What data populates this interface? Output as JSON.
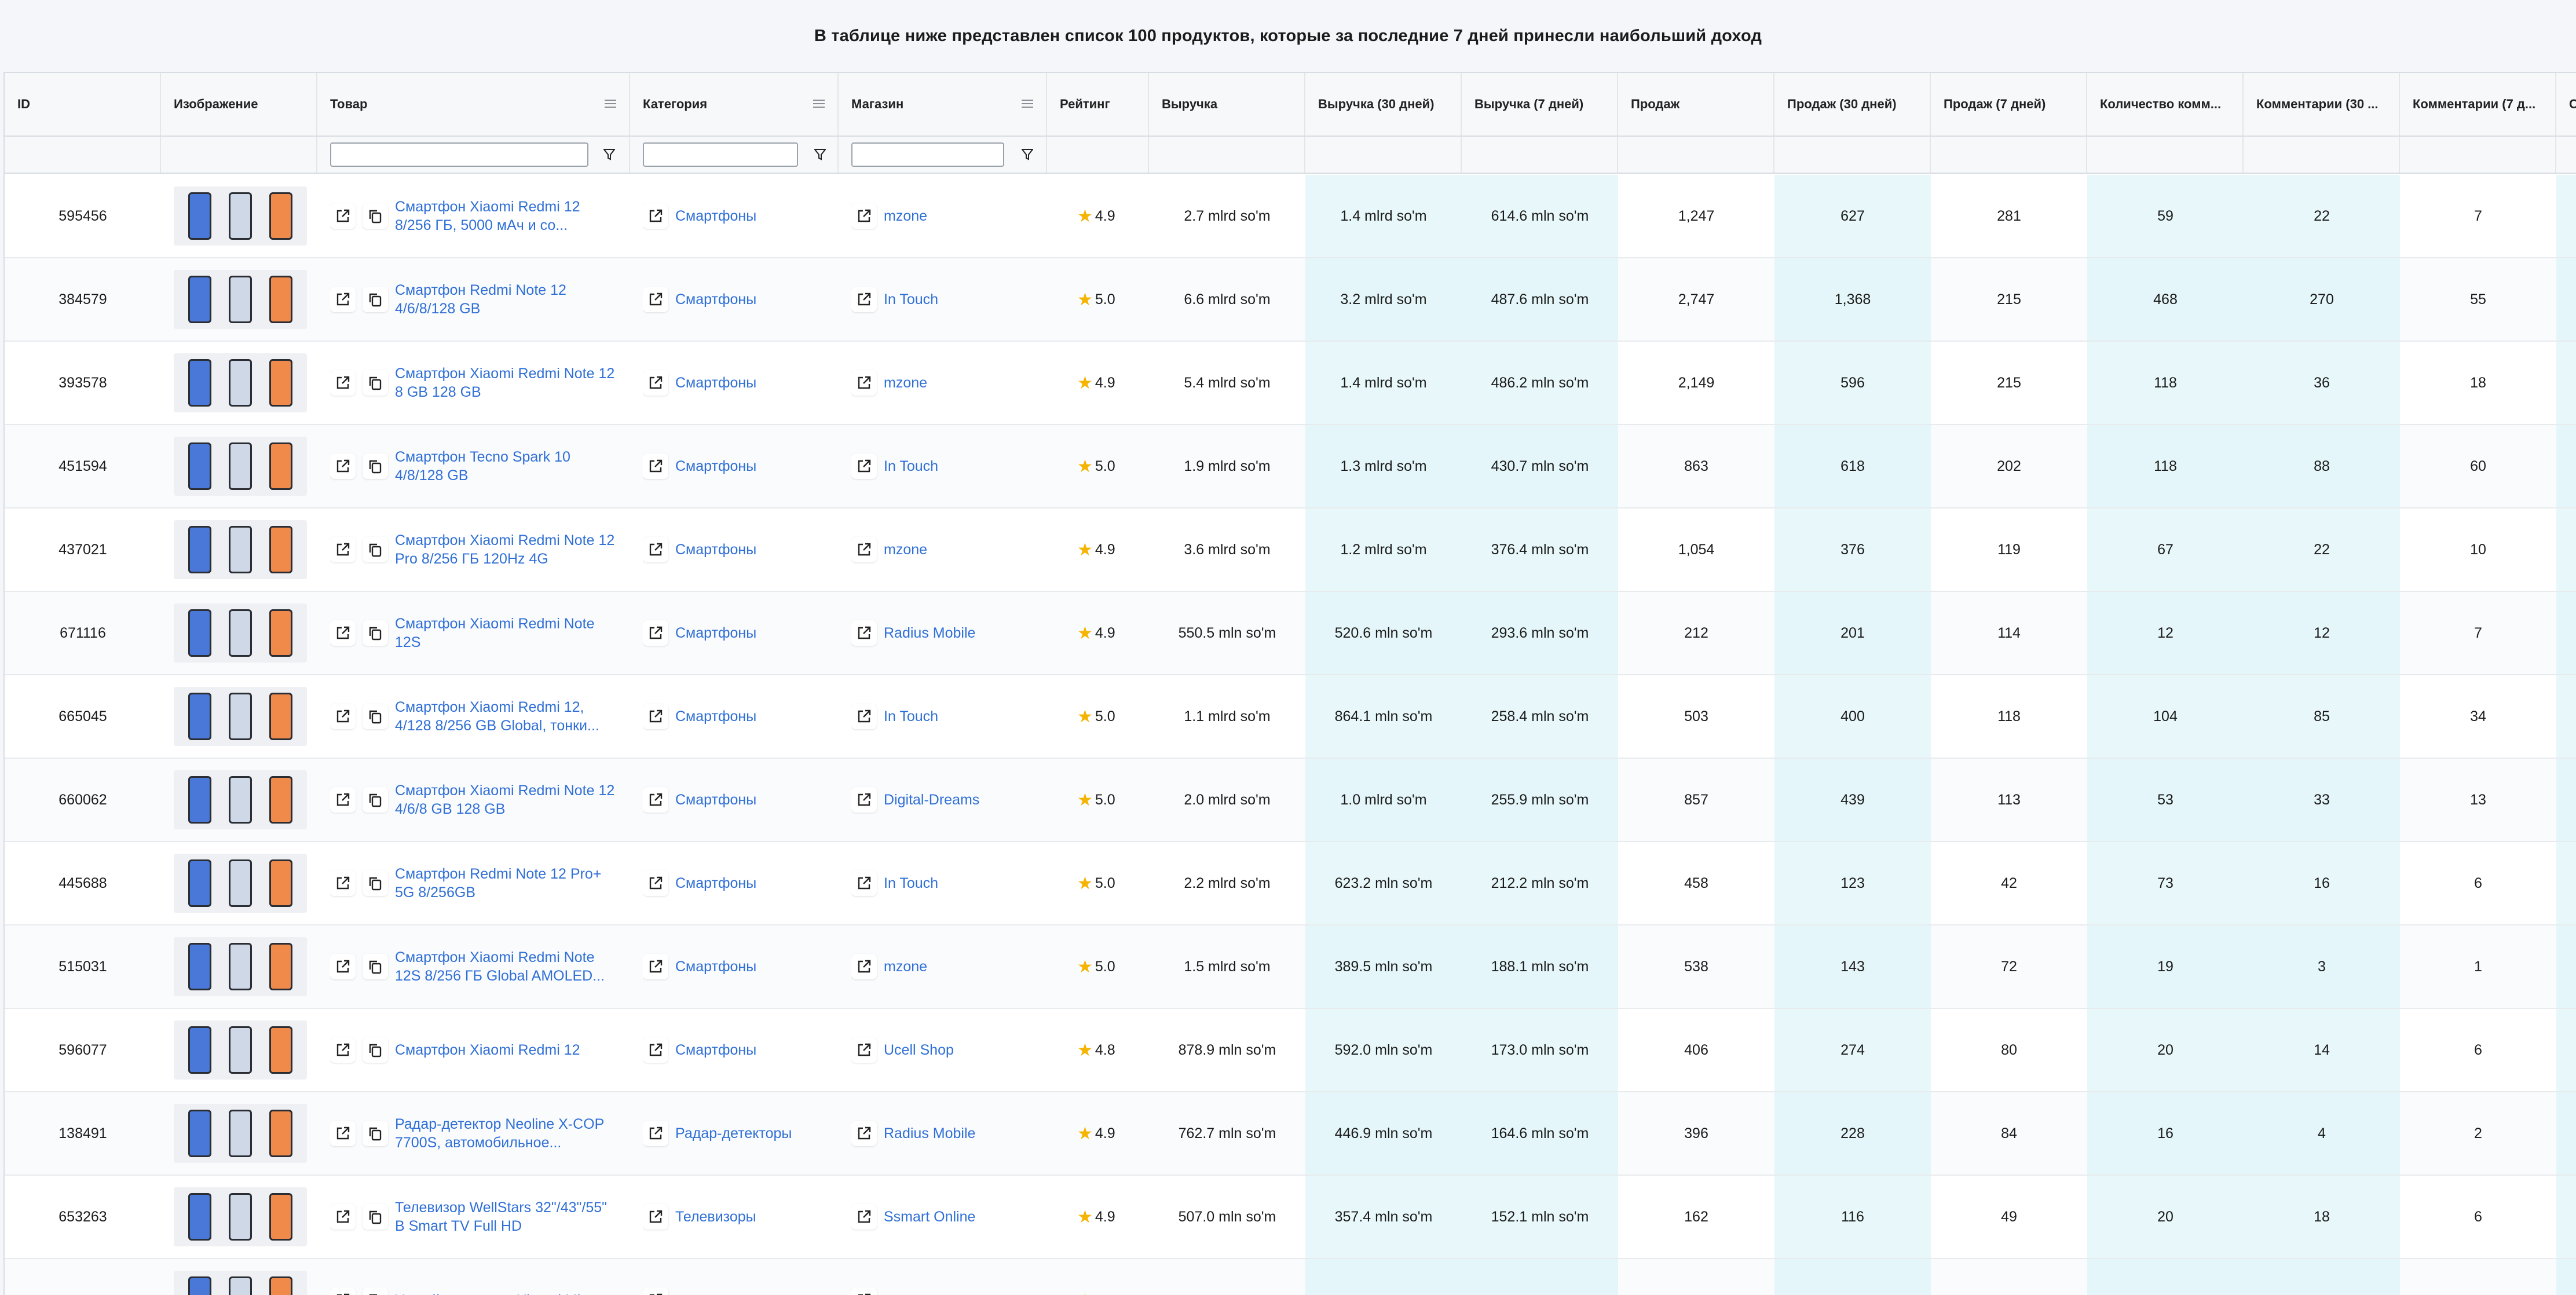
{
  "page_title": "В таблице ниже представлен список 100 продуктов, которые за последние 7 дней принесли наибольший доход",
  "columns": {
    "id": "ID",
    "image": "Изображение",
    "product": "Товар",
    "category": "Категория",
    "shop": "Магазин",
    "rating": "Рейтинг",
    "revenue": "Выручка",
    "revenue30": "Выручка (30 дней)",
    "revenue7": "Выручка (7 дней)",
    "sales": "Продаж",
    "sales30": "Продаж (30 дней)",
    "sales7": "Продаж (7 дней)",
    "comments": "Количество комм...",
    "comments30": "Комментарии (30 ...",
    "comments7": "Комментарии (7 д...",
    "next": "С"
  },
  "filters": {
    "product": "",
    "category": "",
    "shop": ""
  },
  "colors": {
    "link": "#2f6fd6",
    "highlight_column": "#e8f8fa",
    "star": "#f5b400"
  },
  "rows": [
    {
      "id": "595456",
      "product": "Смартфон Xiaomi Redmi 12 8/256 ГБ, 5000 мАч и со...",
      "category": "Смартфоны",
      "shop": "mzone",
      "rating": "4.9",
      "revenue": "2.7 mlrd so'm",
      "revenue30": "1.4 mlrd so'm",
      "revenue7": "614.6 mln so'm",
      "sales": "1,247",
      "sales30": "627",
      "sales7": "281",
      "comments": "59",
      "comments30": "22",
      "comments7": "7"
    },
    {
      "id": "384579",
      "product": "Смартфон Redmi Note 12 4/6/8/128 GB",
      "category": "Смартфоны",
      "shop": "In Touch",
      "rating": "5.0",
      "revenue": "6.6 mlrd so'm",
      "revenue30": "3.2 mlrd so'm",
      "revenue7": "487.6 mln so'm",
      "sales": "2,747",
      "sales30": "1,368",
      "sales7": "215",
      "comments": "468",
      "comments30": "270",
      "comments7": "55"
    },
    {
      "id": "393578",
      "product": "Смартфон Xiaomi Redmi Note 12 8 GB 128 GB",
      "category": "Смартфоны",
      "shop": "mzone",
      "rating": "4.9",
      "revenue": "5.4 mlrd so'm",
      "revenue30": "1.4 mlrd so'm",
      "revenue7": "486.2 mln so'm",
      "sales": "2,149",
      "sales30": "596",
      "sales7": "215",
      "comments": "118",
      "comments30": "36",
      "comments7": "18"
    },
    {
      "id": "451594",
      "product": "Смартфон Tecno Spark 10 4/8/128 GB",
      "category": "Смартфоны",
      "shop": "In Touch",
      "rating": "5.0",
      "revenue": "1.9 mlrd so'm",
      "revenue30": "1.3 mlrd so'm",
      "revenue7": "430.7 mln so'm",
      "sales": "863",
      "sales30": "618",
      "sales7": "202",
      "comments": "118",
      "comments30": "88",
      "comments7": "60"
    },
    {
      "id": "437021",
      "product": "Смартфон Xiaomi Redmi Note 12 Pro 8/256 ГБ 120Hz 4G",
      "category": "Смартфоны",
      "shop": "mzone",
      "rating": "4.9",
      "revenue": "3.6 mlrd so'm",
      "revenue30": "1.2 mlrd so'm",
      "revenue7": "376.4 mln so'm",
      "sales": "1,054",
      "sales30": "376",
      "sales7": "119",
      "comments": "67",
      "comments30": "22",
      "comments7": "10"
    },
    {
      "id": "671116",
      "product": "Смартфон Xiaomi Redmi Note 12S",
      "category": "Смартфоны",
      "shop": "Radius Mobile",
      "rating": "4.9",
      "revenue": "550.5 mln so'm",
      "revenue30": "520.6 mln so'm",
      "revenue7": "293.6 mln so'm",
      "sales": "212",
      "sales30": "201",
      "sales7": "114",
      "comments": "12",
      "comments30": "12",
      "comments7": "7"
    },
    {
      "id": "665045",
      "product": "Смартфон Xiaomi Redmi 12, 4/128 8/256 GB Global, тонки...",
      "category": "Смартфоны",
      "shop": "In Touch",
      "rating": "5.0",
      "revenue": "1.1 mlrd so'm",
      "revenue30": "864.1 mln so'm",
      "revenue7": "258.4 mln so'm",
      "sales": "503",
      "sales30": "400",
      "sales7": "118",
      "comments": "104",
      "comments30": "85",
      "comments7": "34"
    },
    {
      "id": "660062",
      "product": "Смартфон Xiaomi Redmi Note 12 4/6/8 GB 128 GB",
      "category": "Смартфоны",
      "shop": "Digital-Dreams",
      "rating": "5.0",
      "revenue": "2.0 mlrd so'm",
      "revenue30": "1.0 mlrd so'm",
      "revenue7": "255.9 mln so'm",
      "sales": "857",
      "sales30": "439",
      "sales7": "113",
      "comments": "53",
      "comments30": "33",
      "comments7": "13"
    },
    {
      "id": "445688",
      "product": "Смартфон Redmi Note 12 Pro+ 5G 8/256GB",
      "category": "Смартфоны",
      "shop": "In Touch",
      "rating": "5.0",
      "revenue": "2.2 mlrd so'm",
      "revenue30": "623.2 mln so'm",
      "revenue7": "212.2 mln so'm",
      "sales": "458",
      "sales30": "123",
      "sales7": "42",
      "comments": "73",
      "comments30": "16",
      "comments7": "6"
    },
    {
      "id": "515031",
      "product": "Смартфон Xiaomi Redmi Note 12S 8/256 ГБ Global AMOLED...",
      "category": "Смартфоны",
      "shop": "mzone",
      "rating": "5.0",
      "revenue": "1.5 mlrd so'm",
      "revenue30": "389.5 mln so'm",
      "revenue7": "188.1 mln so'm",
      "sales": "538",
      "sales30": "143",
      "sales7": "72",
      "comments": "19",
      "comments30": "3",
      "comments7": "1"
    },
    {
      "id": "596077",
      "product": "Смартфон Xiaomi Redmi 12",
      "category": "Смартфоны",
      "shop": "Ucell Shop",
      "rating": "4.8",
      "revenue": "878.9 mln so'm",
      "revenue30": "592.0 mln so'm",
      "revenue7": "173.0 mln so'm",
      "sales": "406",
      "sales30": "274",
      "sales7": "80",
      "comments": "20",
      "comments30": "14",
      "comments7": "6"
    },
    {
      "id": "138491",
      "product": "Радар-детектор Neoline X-COP 7700S, автомобильное...",
      "category": "Радар-детекторы",
      "shop": "Radius Mobile",
      "rating": "4.9",
      "revenue": "762.7 mln so'm",
      "revenue30": "446.9 mln so'm",
      "revenue7": "164.6 mln so'm",
      "sales": "396",
      "sales30": "228",
      "sales7": "84",
      "comments": "16",
      "comments30": "4",
      "comments7": "2"
    },
    {
      "id": "653263",
      "product": "Телевизор WellStars 32\"/43\"/55\" В Smart TV Full HD",
      "category": "Телевизоры",
      "shop": "Ssmart Online",
      "rating": "4.9",
      "revenue": "507.0 mln so'm",
      "revenue30": "357.4 mln so'm",
      "revenue7": "152.1 mln so'm",
      "sales": "162",
      "sales30": "116",
      "sales7": "49",
      "comments": "20",
      "comments30": "18",
      "comments7": "6"
    },
    {
      "id": "",
      "product": "Умный телевизор Xiaomi Mi",
      "category": "",
      "shop": "",
      "rating": "",
      "revenue": "",
      "revenue30": "",
      "revenue7": "",
      "sales": "",
      "sales30": "",
      "sales7": "",
      "comments": "",
      "comments30": "",
      "comments7": ""
    }
  ]
}
